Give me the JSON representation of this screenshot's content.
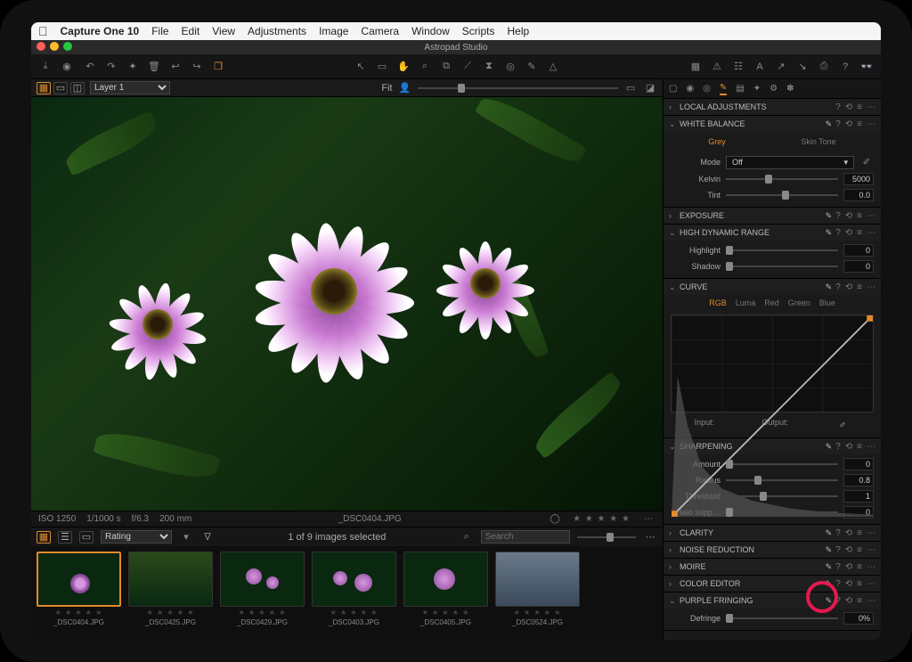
{
  "menubar": {
    "appname": "Capture One 10",
    "items": [
      "File",
      "Edit",
      "View",
      "Adjustments",
      "Image",
      "Camera",
      "Window",
      "Scripts",
      "Help"
    ]
  },
  "titlebar": {
    "title": "Astropad Studio"
  },
  "layerbar": {
    "layer": "Layer 1",
    "fit": "Fit"
  },
  "viewer": {
    "status": {
      "iso": "ISO 1250",
      "shutter": "1/1000 s",
      "aperture": "f/6.3",
      "focal": "200 mm"
    },
    "filename": "_DSC0404.JPG",
    "rating": "★ ★ ★ ★ ★"
  },
  "browser": {
    "sort_label": "Rating",
    "selection": "1 of 9 images selected",
    "search_placeholder": "Search"
  },
  "thumbs": [
    {
      "name": "_DSC0404.JPG",
      "selected": true
    },
    {
      "name": "_DSC0425.JPG",
      "selected": false
    },
    {
      "name": "_DSC0429.JPG",
      "selected": false
    },
    {
      "name": "_DSC0403.JPG",
      "selected": false
    },
    {
      "name": "_DSC0405.JPG",
      "selected": false
    },
    {
      "name": "_DSC0524.JPG",
      "selected": false
    }
  ],
  "panels": {
    "local_adjustments": {
      "title": "LOCAL ADJUSTMENTS"
    },
    "white_balance": {
      "title": "WHITE BALANCE",
      "tabs": {
        "grey": "Grey",
        "skin": "Skin Tone"
      },
      "mode_label": "Mode",
      "mode_value": "Off",
      "kelvin_label": "Kelvin",
      "kelvin_value": "5000",
      "tint_label": "Tint",
      "tint_value": "0.0"
    },
    "exposure": {
      "title": "EXPOSURE"
    },
    "hdr": {
      "title": "HIGH DYNAMIC RANGE",
      "highlight_label": "Highlight",
      "highlight_value": "0",
      "shadow_label": "Shadow",
      "shadow_value": "0"
    },
    "curve": {
      "title": "CURVE",
      "tabs": [
        "RGB",
        "Luma",
        "Red",
        "Green",
        "Blue"
      ],
      "input_label": "Input:",
      "output_label": "Output:"
    },
    "sharpening": {
      "title": "SHARPENING",
      "amount_label": "Amount",
      "amount_value": "0",
      "radius_label": "Radius",
      "radius_value": "0.8",
      "threshold_label": "Threshold",
      "threshold_value": "1",
      "halo_label": "Halo supp…",
      "halo_value": "0"
    },
    "clarity": {
      "title": "CLARITY"
    },
    "noise": {
      "title": "NOISE REDUCTION"
    },
    "moire": {
      "title": "MOIRE"
    },
    "coloreditor": {
      "title": "COLOR EDITOR"
    },
    "purple": {
      "title": "PURPLE FRINGING",
      "defringe_label": "Defringe",
      "defringe_value": "0%"
    }
  }
}
